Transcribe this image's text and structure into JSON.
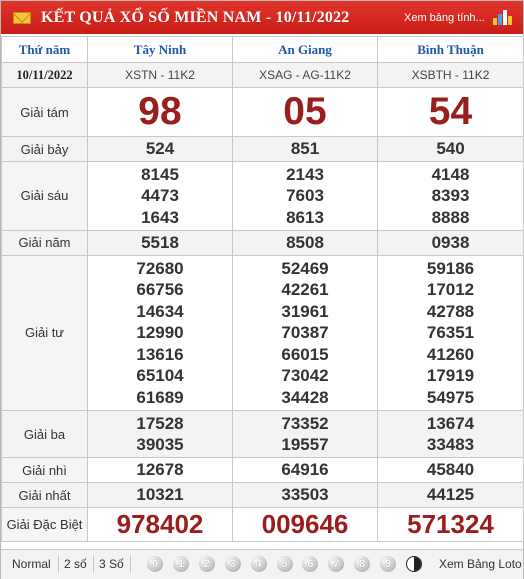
{
  "header": {
    "title": "KẾT QUẢ XỔ SỐ MIỀN NAM - 10/11/2022",
    "more_link": "Xem bảng tính..."
  },
  "table": {
    "corner_label": "Thứ năm",
    "date": "10/11/2022",
    "provinces": [
      {
        "name": "Tây Ninh",
        "code": "XSTN - 11K2"
      },
      {
        "name": "An Giang",
        "code": "XSAG - AG-11K2"
      },
      {
        "name": "Bình Thuận",
        "code": "XSBTH - 11K2"
      }
    ],
    "prizes": [
      {
        "label": "Giải tám",
        "values": [
          [
            "98"
          ],
          [
            "05"
          ],
          [
            "54"
          ]
        ]
      },
      {
        "label": "Giải bảy",
        "values": [
          [
            "524"
          ],
          [
            "851"
          ],
          [
            "540"
          ]
        ]
      },
      {
        "label": "Giải sáu",
        "values": [
          [
            "8145",
            "4473",
            "1643"
          ],
          [
            "2143",
            "7603",
            "8613"
          ],
          [
            "4148",
            "8393",
            "8888"
          ]
        ]
      },
      {
        "label": "Giải năm",
        "values": [
          [
            "5518"
          ],
          [
            "8508"
          ],
          [
            "0938"
          ]
        ]
      },
      {
        "label": "Giải tư",
        "values": [
          [
            "72680",
            "66756",
            "14634",
            "12990",
            "13616",
            "65104",
            "61689"
          ],
          [
            "52469",
            "42261",
            "31961",
            "70387",
            "66015",
            "73042",
            "34428"
          ],
          [
            "59186",
            "17012",
            "42788",
            "76351",
            "41260",
            "17919",
            "54975"
          ]
        ]
      },
      {
        "label": "Giải ba",
        "values": [
          [
            "17528",
            "39035"
          ],
          [
            "73352",
            "19557"
          ],
          [
            "13674",
            "33483"
          ]
        ]
      },
      {
        "label": "Giải nhì",
        "values": [
          [
            "12678"
          ],
          [
            "64916"
          ],
          [
            "45840"
          ]
        ]
      },
      {
        "label": "Giải nhất",
        "values": [
          [
            "10321"
          ],
          [
            "33503"
          ],
          [
            "44125"
          ]
        ]
      },
      {
        "label": "Giải Đặc Biệt",
        "values": [
          [
            "978402"
          ],
          [
            "009646"
          ],
          [
            "571324"
          ]
        ]
      }
    ]
  },
  "footer": {
    "options": [
      "Normal",
      "2 số",
      "3 Số"
    ],
    "digits": [
      "0",
      "1",
      "2",
      "3",
      "4",
      "5",
      "6",
      "7",
      "8",
      "9"
    ],
    "more_link": "Xem Bảng Loto"
  },
  "colors": {
    "header_bg": "#d42a22",
    "province_text": "#1f5aa8",
    "highlight_number": "#9a1e1e"
  }
}
